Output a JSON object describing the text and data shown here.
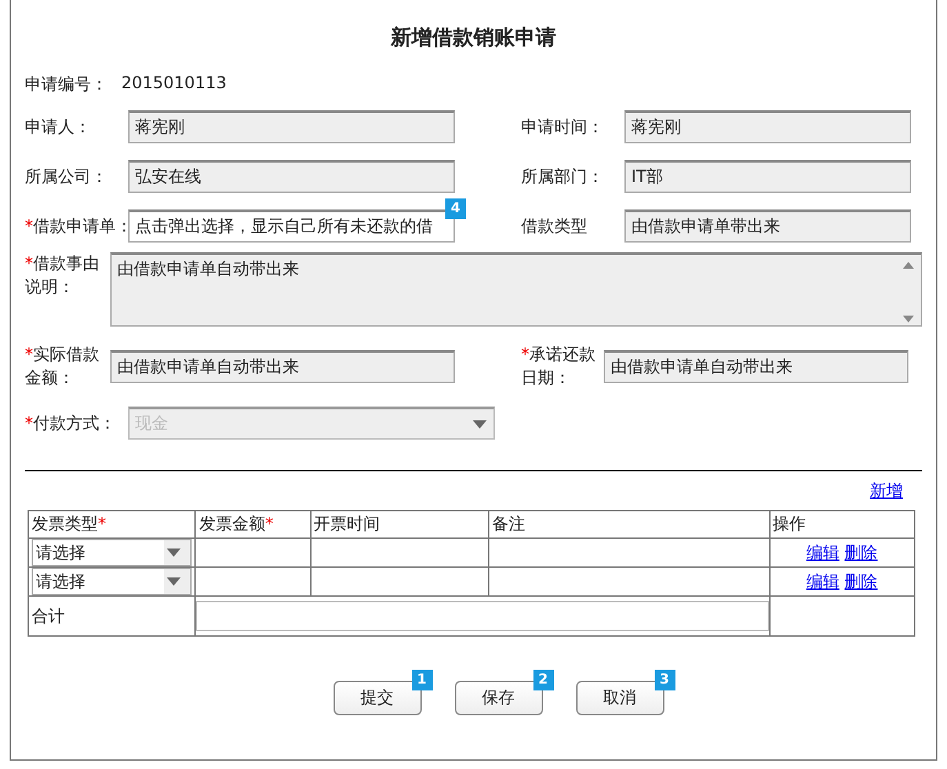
{
  "title": "新增借款销账申请",
  "required_mark": "*",
  "application_no": {
    "label": "申请编号：",
    "value": "2015010113"
  },
  "rows": [
    {
      "fields": [
        {
          "kind": "readonly",
          "label": "申请人：",
          "required": false,
          "value": "蒋宪刚"
        },
        {
          "kind": "readonly",
          "label": "申请时间：",
          "required": false,
          "value": "蒋宪刚"
        }
      ]
    },
    {
      "fields": [
        {
          "kind": "readonly",
          "label": "所属公司：",
          "required": false,
          "value": "弘安在线"
        },
        {
          "kind": "readonly",
          "label": "所属部门：",
          "required": false,
          "value": "IT部"
        }
      ]
    },
    {
      "fields": [
        {
          "kind": "input",
          "label": "借款申请单：",
          "required": true,
          "value": "点击弹出选择，显示自己所有未还款的借",
          "badge": "4"
        },
        {
          "kind": "readonly",
          "label": "借款类型",
          "required": false,
          "value": "由借款申请单带出来"
        }
      ]
    },
    {
      "fields": [
        {
          "kind": "textarea",
          "label": "借款事由说明：",
          "required": true,
          "value": "由借款申请单自动带出来"
        }
      ]
    },
    {
      "fields": [
        {
          "kind": "readonly",
          "label": "实际借款金额：",
          "required": true,
          "value": "由借款申请单自动带出来"
        },
        {
          "kind": "readonly",
          "label": "承诺还款日期：",
          "required": true,
          "value": "由借款申请单自动带出来"
        }
      ]
    },
    {
      "fields": [
        {
          "kind": "select",
          "label": "付款方式：",
          "required": true,
          "value": "现金",
          "disabled": true
        }
      ]
    }
  ],
  "add_link": "新增",
  "table": {
    "columns": [
      {
        "label": "发票类型",
        "required": true
      },
      {
        "label": "发票金额",
        "required": true
      },
      {
        "label": "开票时间",
        "required": false
      },
      {
        "label": "备注",
        "required": false
      },
      {
        "label": "操作",
        "required": false
      }
    ],
    "rows": [
      {
        "type": "请选择",
        "actions": [
          "编辑",
          "删除"
        ]
      },
      {
        "type": "请选择",
        "actions": [
          "编辑",
          "删除"
        ]
      }
    ],
    "total_label": "合计"
  },
  "buttons": [
    {
      "label": "提交",
      "badge": "1"
    },
    {
      "label": "保存",
      "badge": "2"
    },
    {
      "label": "取消",
      "badge": "3"
    }
  ]
}
